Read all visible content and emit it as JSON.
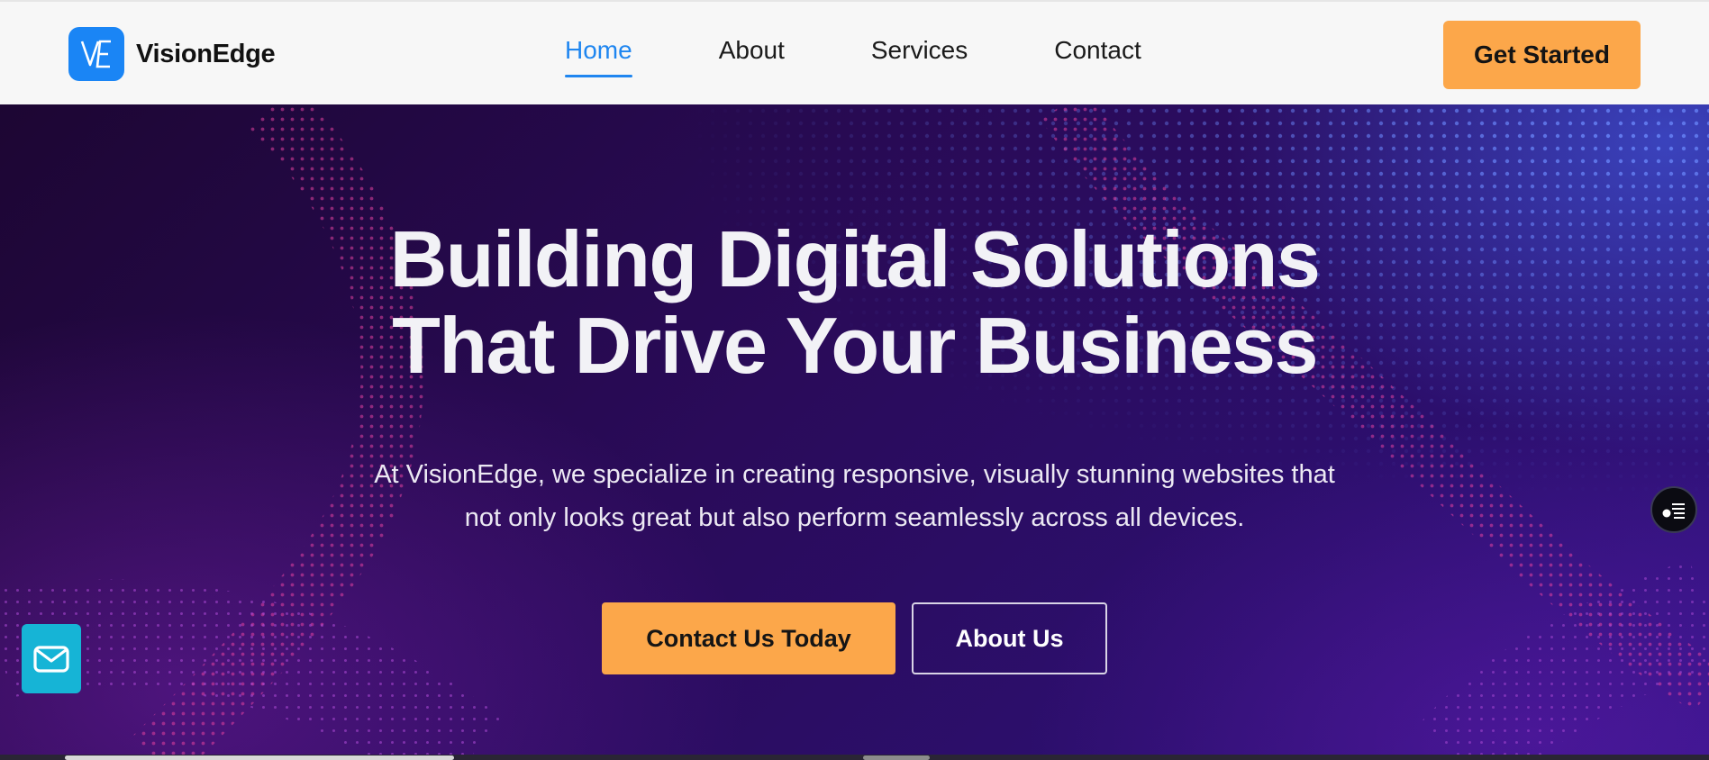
{
  "brand": {
    "name": "VisionEdge",
    "logo_text": "VE",
    "logo_color": "#1a85f5"
  },
  "nav": {
    "items": [
      {
        "label": "Home",
        "active": true
      },
      {
        "label": "About",
        "active": false
      },
      {
        "label": "Services",
        "active": false
      },
      {
        "label": "Contact",
        "active": false
      }
    ],
    "cta_label": "Get Started"
  },
  "hero": {
    "title_line1": "Building Digital Solutions",
    "title_line2": "That Drive Your Business",
    "text_line1": "At VisionEdge, we specialize in creating responsive, visually stunning websites that",
    "text_line2": "not only looks great but also perform seamlessly across all devices.",
    "primary_button": "Contact Us Today",
    "secondary_button": "About Us"
  },
  "widgets": {
    "mail_icon": "mail-icon",
    "side_icon": "accessibility-menu-icon"
  },
  "colors": {
    "accent": "#fca74a",
    "nav_active": "#1f86f0",
    "mail_fab": "#16b4d6",
    "header_bg": "#f7f7f7"
  }
}
